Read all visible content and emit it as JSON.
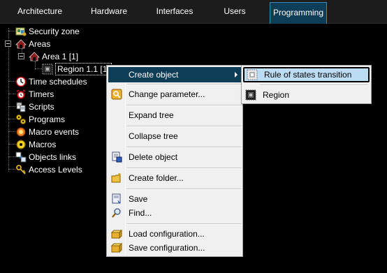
{
  "tabs": [
    {
      "label": "Architecture",
      "active": false
    },
    {
      "label": "Hardware",
      "active": false
    },
    {
      "label": "Interfaces",
      "active": false
    },
    {
      "label": "Users",
      "active": false
    },
    {
      "label": "Programming",
      "active": true
    }
  ],
  "tree": {
    "security_zone": "Security zone",
    "areas": "Areas",
    "area1": "Area 1 [1]",
    "region": "Region 1.1 [1.",
    "time_schedules": "Time schedules",
    "timers": "Timers",
    "scripts": "Scripts",
    "programs": "Programs",
    "macro_events": "Macro events",
    "macros": "Macros",
    "objects_links": "Objects links",
    "access_levels": "Access Levels"
  },
  "context_menu": {
    "create_object": "Create object",
    "change_parameter": "Change parameter...",
    "expand_tree": "Expand tree",
    "collapse_tree": "Collapse tree",
    "delete_object": "Delete object",
    "create_folder": "Create folder...",
    "save": "Save",
    "find": "Find...",
    "load_configuration": "Load configuration...",
    "save_configuration": "Save configuration..."
  },
  "submenu": {
    "rule_of_states_transition": "Rule of states transition",
    "region": "Region"
  },
  "colors": {
    "background": "#000000",
    "tab_active": "#0e3d57",
    "menu_highlight": "#0e3d57",
    "submenu_highlight": "#bcdcf4",
    "menu_background": "#f0f0f0"
  }
}
